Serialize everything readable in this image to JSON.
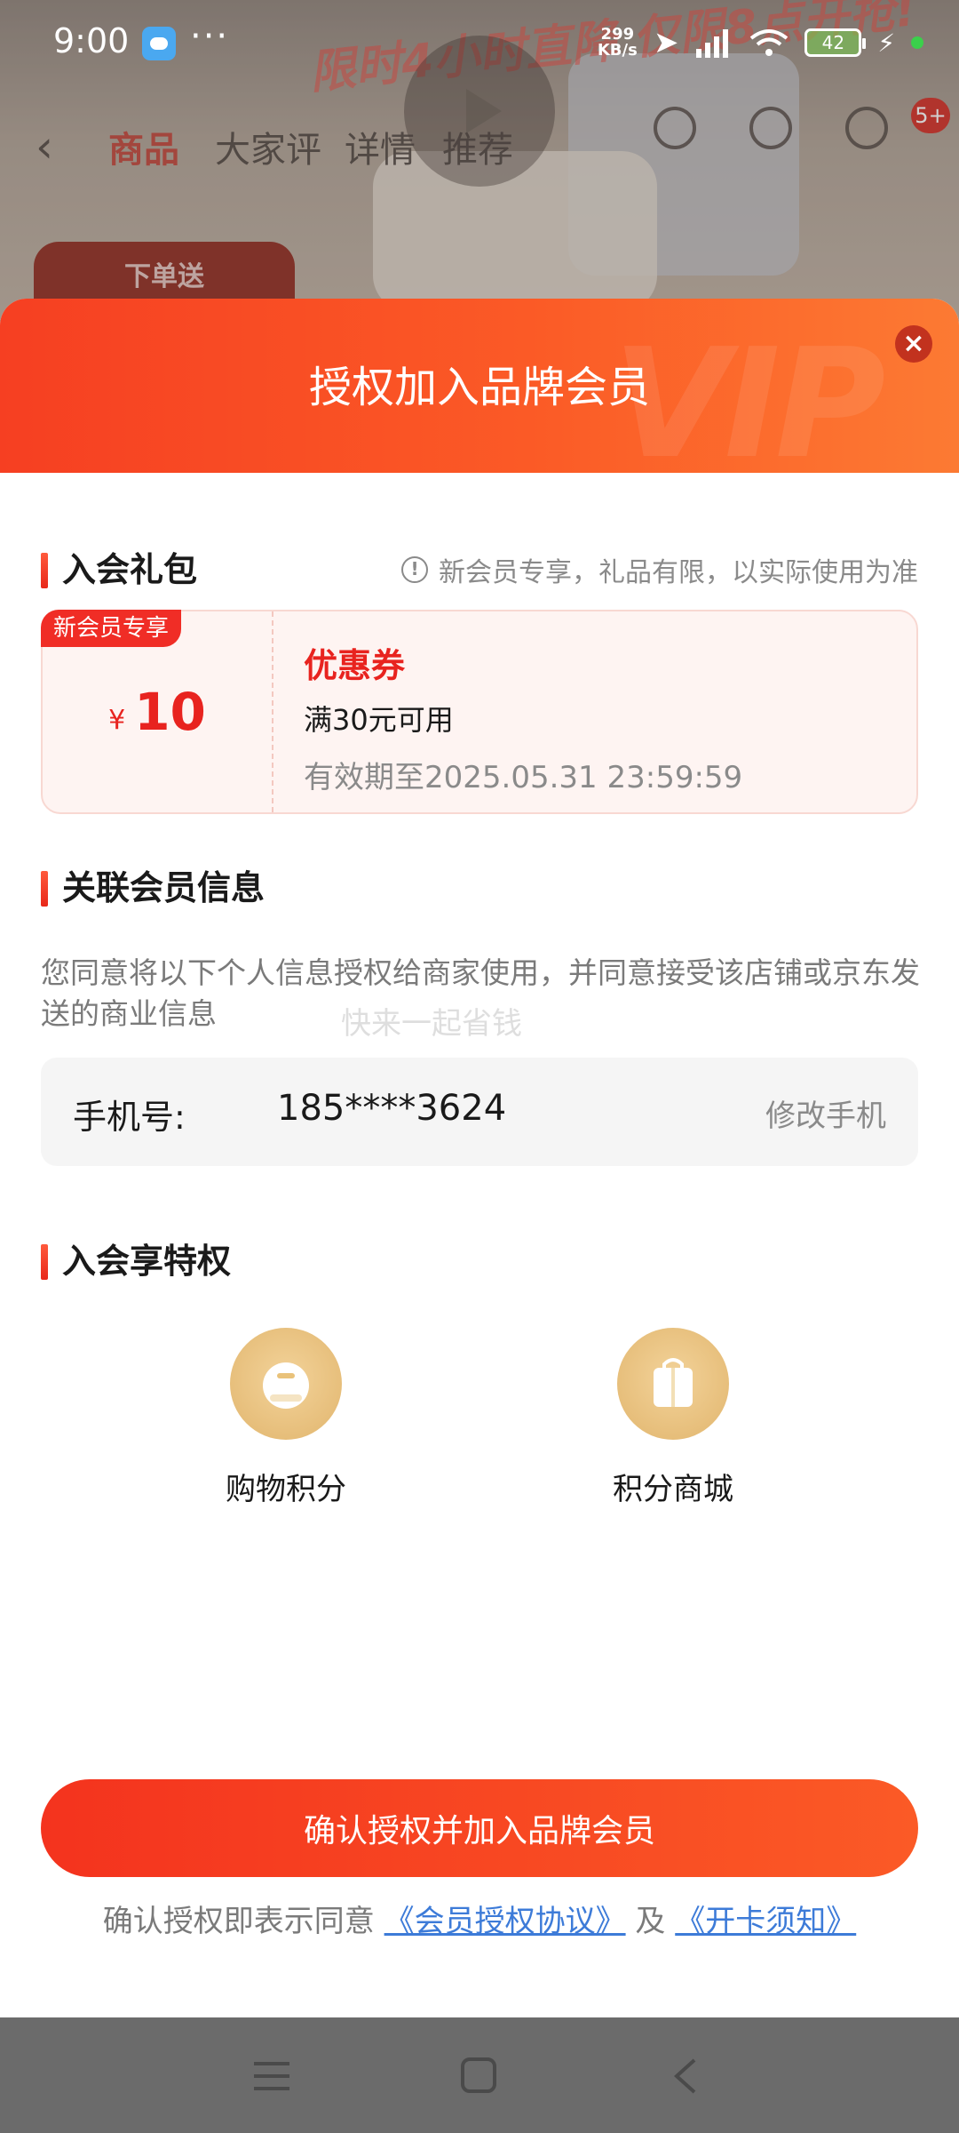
{
  "background": {
    "promo_text": "限时4小时直降 仅限8点开抢!",
    "gift_tag": "下单送",
    "tabs": [
      "商品",
      "大家评",
      "详情",
      "推荐"
    ],
    "cart_badge": "5+"
  },
  "status_bar": {
    "time": "9:00",
    "more": "···",
    "speed_value": "299",
    "speed_unit": "KB/s",
    "battery": "42"
  },
  "sheet": {
    "title": "授权加入品牌会员",
    "close_label": "×",
    "gift_section": {
      "title": "入会礼包",
      "notice": "新会员专享，礼品有限，以实际使用为准",
      "coupon": {
        "tag": "新会员专享",
        "currency": "¥",
        "amount": "10",
        "type": "优惠券",
        "condition": "满30元可用",
        "validity": "有效期至2025.05.31 23:59:59"
      }
    },
    "member_info_section": {
      "title": "关联会员信息",
      "description": "您同意将以下个人信息授权给商家使用，并同意接受该店铺或京东发送的商业信息",
      "slogan": "快来一起省钱",
      "phone_label": "手机号:",
      "phone_value": "185****3624",
      "edit_phone": "修改手机"
    },
    "privileges_section": {
      "title": "入会享特权",
      "items": [
        {
          "label": "购物积分",
          "icon": "shopping-points-icon"
        },
        {
          "label": "积分商城",
          "icon": "points-mall-icon"
        }
      ]
    },
    "confirm_button": "确认授权并加入品牌会员",
    "agreement": {
      "prefix": "确认授权即表示同意",
      "link1": "《会员授权协议》",
      "conjunction": "及",
      "link2": "《开卡须知》"
    }
  },
  "colors": {
    "accent": "#f63f22",
    "link": "#3d7bd8",
    "coupon_red": "#e8231f"
  }
}
